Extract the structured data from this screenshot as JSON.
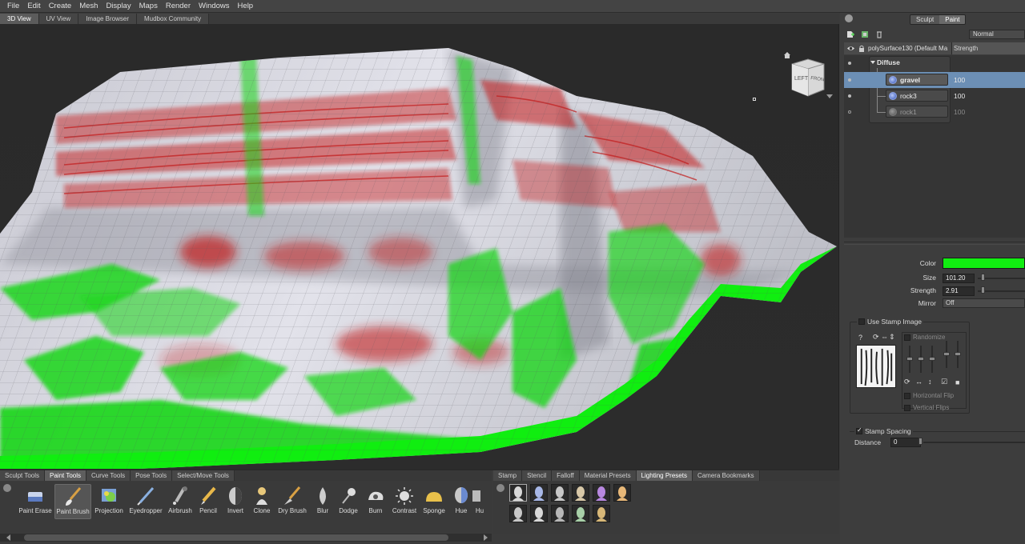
{
  "menubar": {
    "items": [
      "File",
      "Edit",
      "Create",
      "Mesh",
      "Display",
      "Maps",
      "Render",
      "Windows",
      "Help"
    ]
  },
  "view_tabs": [
    "3D View",
    "UV View",
    "Image Browser",
    "Mudbox Community"
  ],
  "viewcube": {
    "left_label": "LEFT",
    "front_label": "FRON"
  },
  "right_panel": {
    "mode_toggle": [
      "Sculpt",
      "Paint"
    ],
    "blend_mode": "Normal",
    "layer_header": {
      "object": "polySurface130 (Default Ma",
      "column": "Strength"
    },
    "group": {
      "name": "Diffuse"
    },
    "layers": [
      {
        "name": "gravel",
        "value": "100"
      },
      {
        "name": "rock3",
        "value": "100"
      },
      {
        "name": "rock1",
        "value": "100"
      }
    ],
    "properties": {
      "color_label": "Color",
      "color_value": "#11ee11",
      "size_label": "Size",
      "size_value": "101.20",
      "strength_label": "Strength",
      "strength_value": "2.91",
      "mirror_label": "Mirror",
      "mirror_value": "Off"
    },
    "stamp": {
      "use_label": "Use Stamp Image",
      "randomize_label": "Randomize",
      "hflip_label": "Horizontal Flip",
      "vflip_label": "Vertical Flips"
    },
    "spacing": {
      "label": "Stamp Spacing",
      "distance_label": "Distance",
      "distance_value": "0"
    }
  },
  "shelf_tabs_left": [
    "Sculpt Tools",
    "Paint Tools",
    "Curve Tools",
    "Pose Tools",
    "Select/Move Tools"
  ],
  "shelf_tabs_right": [
    "Stamp",
    "Stencil",
    "Falloff",
    "Material Presets",
    "Lighting Presets",
    "Camera Bookmarks"
  ],
  "paint_tools": [
    {
      "label": "Paint Erase",
      "icon": "paint-erase-icon"
    },
    {
      "label": "Paint Brush",
      "icon": "paint-brush-icon"
    },
    {
      "label": "Projection",
      "icon": "projection-icon"
    },
    {
      "label": "Eyedropper",
      "icon": "eyedropper-icon"
    },
    {
      "label": "Airbrush",
      "icon": "airbrush-icon"
    },
    {
      "label": "Pencil",
      "icon": "pencil-icon"
    },
    {
      "label": "Invert",
      "icon": "invert-icon"
    },
    {
      "label": "Clone",
      "icon": "clone-icon"
    },
    {
      "label": "Dry Brush",
      "icon": "dry-brush-icon"
    },
    {
      "label": "Blur",
      "icon": "blur-icon"
    },
    {
      "label": "Dodge",
      "icon": "dodge-icon"
    },
    {
      "label": "Burn",
      "icon": "burn-icon"
    },
    {
      "label": "Contrast",
      "icon": "contrast-icon"
    },
    {
      "label": "Sponge",
      "icon": "sponge-icon"
    },
    {
      "label": "Hue",
      "icon": "hue-icon"
    },
    {
      "label": "Hu",
      "icon": "hue-shift-icon"
    }
  ],
  "colors": {
    "accent_selected": "#6c8fb5",
    "paint_green": "#11ee11",
    "paint_red": "#cc2020"
  }
}
